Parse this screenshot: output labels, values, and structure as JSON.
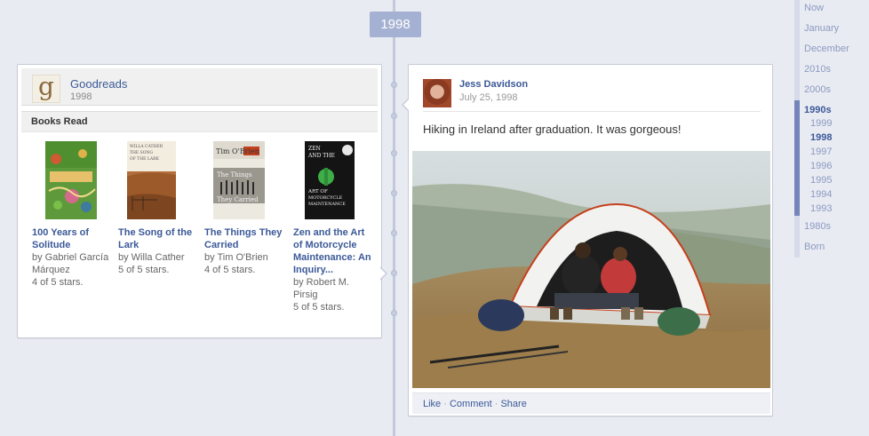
{
  "timeline": {
    "year_marker": "1998"
  },
  "goodreads_card": {
    "app_name": "Goodreads",
    "app_year": "1998",
    "section_title": "Books Read",
    "books": [
      {
        "title": "100 Years of Solitude",
        "author": "by Gabriel García Márquez",
        "rating": "4 of 5 stars."
      },
      {
        "title": "The Song of the Lark",
        "author": "by Willa Cather",
        "rating": "5 of 5 stars."
      },
      {
        "title": "The Things They Carried",
        "author": "by Tim O'Brien",
        "rating": "4 of 5 stars."
      },
      {
        "title": "Zen and the Art of Motorcycle Maintenance: An Inquiry...",
        "author": "by Robert M. Pirsig",
        "rating": "5 of 5 stars."
      }
    ],
    "cover_text": {
      "book2_top": "WILLA CATHER\nTHE SONG\nOF THE LARK",
      "book3_top": "Tim O'Brien",
      "book3_mid": "The Things\nThey Carried",
      "book4_top": "ZEN\nAND THE\nART OF\nMOTORCYCLE\nMAINTENANCE"
    }
  },
  "post_card": {
    "poster_name": "Jess Davidson",
    "post_date": "July 25, 1998",
    "post_text": "Hiking in Ireland after graduation. It was gorgeous!",
    "actions": {
      "like": "Like",
      "comment": "Comment",
      "share": "Share",
      "separator": "·"
    }
  },
  "year_nav": {
    "items": [
      {
        "label": "Now"
      },
      {
        "label": "January"
      },
      {
        "label": "December"
      },
      {
        "label": "2010s"
      },
      {
        "label": "2000s"
      },
      {
        "label": "1990s"
      },
      {
        "label": "1999"
      },
      {
        "label": "1998"
      },
      {
        "label": "1997"
      },
      {
        "label": "1996"
      },
      {
        "label": "1995"
      },
      {
        "label": "1994"
      },
      {
        "label": "1993"
      },
      {
        "label": "1980s"
      },
      {
        "label": "Born"
      }
    ]
  },
  "colors": {
    "link": "#3b5998",
    "background": "#e9ebf2",
    "year_marker": "#a5b1d2",
    "nav_active": "#7485ba"
  }
}
